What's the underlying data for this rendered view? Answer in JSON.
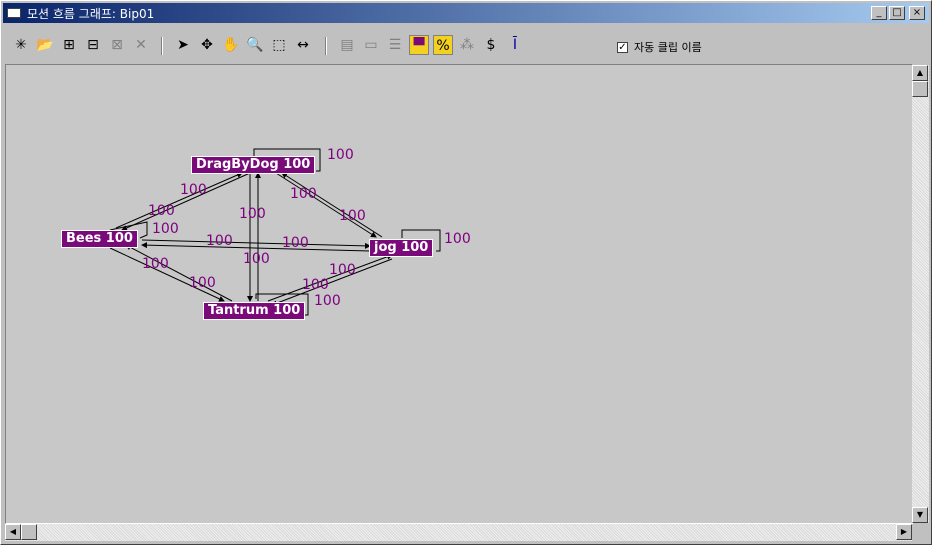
{
  "window": {
    "title": "모션 흐름 그래프: Bip01"
  },
  "titlebar_buttons": {
    "minimize": "_",
    "maximize": "□",
    "close": "×"
  },
  "toolbar": {
    "auto_clip_name_label": "자동 클립 이름",
    "auto_clip_name_checked": true,
    "dollar": "$",
    "percent": "%"
  },
  "nodes": {
    "dragbydog": "DragByDog 100",
    "bees": "Bees 100",
    "jog": "jog 100",
    "tantrum": "Tantrum 100"
  },
  "edge_labels": {
    "dragbydog_self": "100",
    "jog_self": "100",
    "tantrum_self": "100",
    "bees_dragbydog_a": "100",
    "bees_dragbydog_b": "100",
    "bees_self": "100",
    "bees_jog_a": "100",
    "bees_jog_b": "100",
    "dragbydog_tantrum": "100",
    "dragbydog_tantrum_b": "100",
    "dragbydog_jog_a": "100",
    "dragbydog_jog_b": "100",
    "bees_tantrum_a": "100",
    "bees_tantrum_b": "100",
    "tantrum_jog_a": "100",
    "tantrum_jog_b": "100"
  }
}
